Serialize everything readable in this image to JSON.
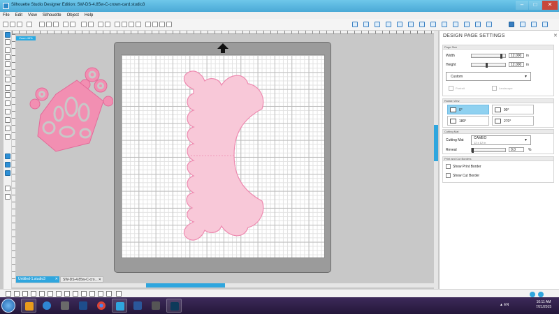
{
  "window": {
    "title": "Silhouette Studio Designer Edition: SW-DS-4.85w-C-crown-card.studio3",
    "min_glyph": "–",
    "max_glyph": "□",
    "close_glyph": "✕"
  },
  "menu": [
    "File",
    "Edit",
    "View",
    "Silhouette",
    "Object",
    "Help"
  ],
  "zoom_tag": "Zoom 45%",
  "tabs": [
    {
      "label": "Untitled-1.studio3",
      "active": true
    },
    {
      "label": "SW-DS-4.85w-C-cro...",
      "active": false
    }
  ],
  "tab_close": "✕",
  "panel": {
    "title": "DESIGN PAGE SETTINGS",
    "close": "✕",
    "page_size": {
      "section": "Page Size",
      "width_label": "Width",
      "width_value": "12.000",
      "height_label": "Height",
      "height_value": "12.000",
      "unit": "in",
      "preset": "Custom",
      "portrait": "Portrait",
      "landscape": "Landscape"
    },
    "rotate": {
      "section": "Rotate View",
      "options": [
        "0°",
        "90°",
        "180°",
        "270°"
      ],
      "selected": "0°"
    },
    "cutting_mat": {
      "section": "Cutting Mat",
      "label": "Cutting Mat",
      "value": "CAMEO",
      "subvalue": "12 x 12 in",
      "reveal_label": "Reveal",
      "reveal_value": "0.0",
      "reveal_unit": "%"
    },
    "borders": {
      "section": "Print and Cut Borders",
      "show_print": "Show Print Border",
      "show_cut": "Show Cut Border"
    }
  },
  "taskbar": {
    "apps": [
      "Outlook",
      "Internet Explorer",
      "Metro",
      "Chrome",
      "Silhouette",
      "Word",
      "Vault",
      "Silhouette Studio",
      "Photoshop"
    ],
    "lang": "▲ EN",
    "time": "10:11 AM",
    "date": "7/21/2015"
  },
  "colors": {
    "accent": "#2fa6de",
    "shape_fill": "#f8c8d8",
    "shape_stroke": "#ee8ab0",
    "crown_fill": "#f28fb2"
  }
}
